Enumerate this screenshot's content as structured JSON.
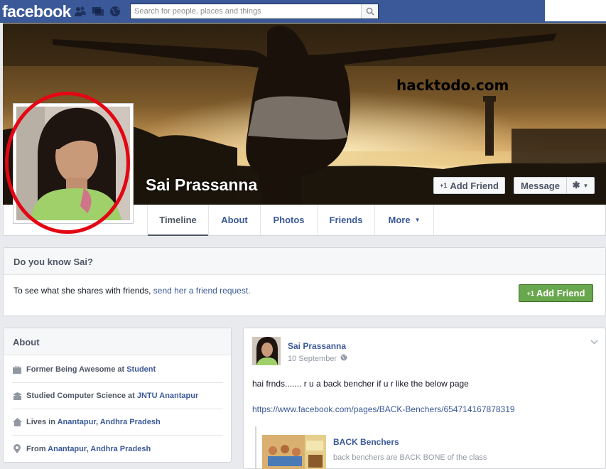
{
  "topbar": {
    "logo": "facebook",
    "search_placeholder": "Search for people, places and things",
    "icons": [
      "friends-icon",
      "messages-icon",
      "globe-icon",
      "search-icon"
    ]
  },
  "cover": {
    "watermark": "hacktodo.com"
  },
  "profile": {
    "name": "Sai Prassanna",
    "add_friend": "Add Friend",
    "add_friend_prefix": "+1",
    "message": "Message"
  },
  "nav": {
    "tabs": [
      "Timeline",
      "About",
      "Photos",
      "Friends",
      "More"
    ],
    "active": "Timeline"
  },
  "know": {
    "heading": "Do you know Sai?",
    "text": "To see what she shares with friends, ",
    "link": "send her a friend request.",
    "button": "Add Friend",
    "button_prefix": "+1"
  },
  "about": {
    "heading": "About",
    "items": [
      {
        "icon": "briefcase-icon",
        "prefix": "Former Being Awesome at ",
        "link": "Student"
      },
      {
        "icon": "school-icon",
        "prefix": "Studied Computer Science at ",
        "link": "JNTU Anantapur"
      },
      {
        "icon": "home-icon",
        "prefix": "Lives in ",
        "link": "Anantapur, Andhra Pradesh"
      },
      {
        "icon": "location-pin-icon",
        "prefix": "From ",
        "link": "Anantapur, Andhra Pradesh"
      }
    ]
  },
  "post": {
    "author": "Sai Prassanna",
    "date": "10 September",
    "text": "hai frnds....... r u a back bencher if u r like the below page",
    "url": "https://www.facebook.com/pages/BACK-Benchers/654714167878319",
    "share_title": "BACK Benchers",
    "share_desc": "back benchers are BACK BONE of the class"
  },
  "colors": {
    "brand": "#3b5998",
    "green": "#69a74e",
    "annotation_red": "#e30613"
  }
}
